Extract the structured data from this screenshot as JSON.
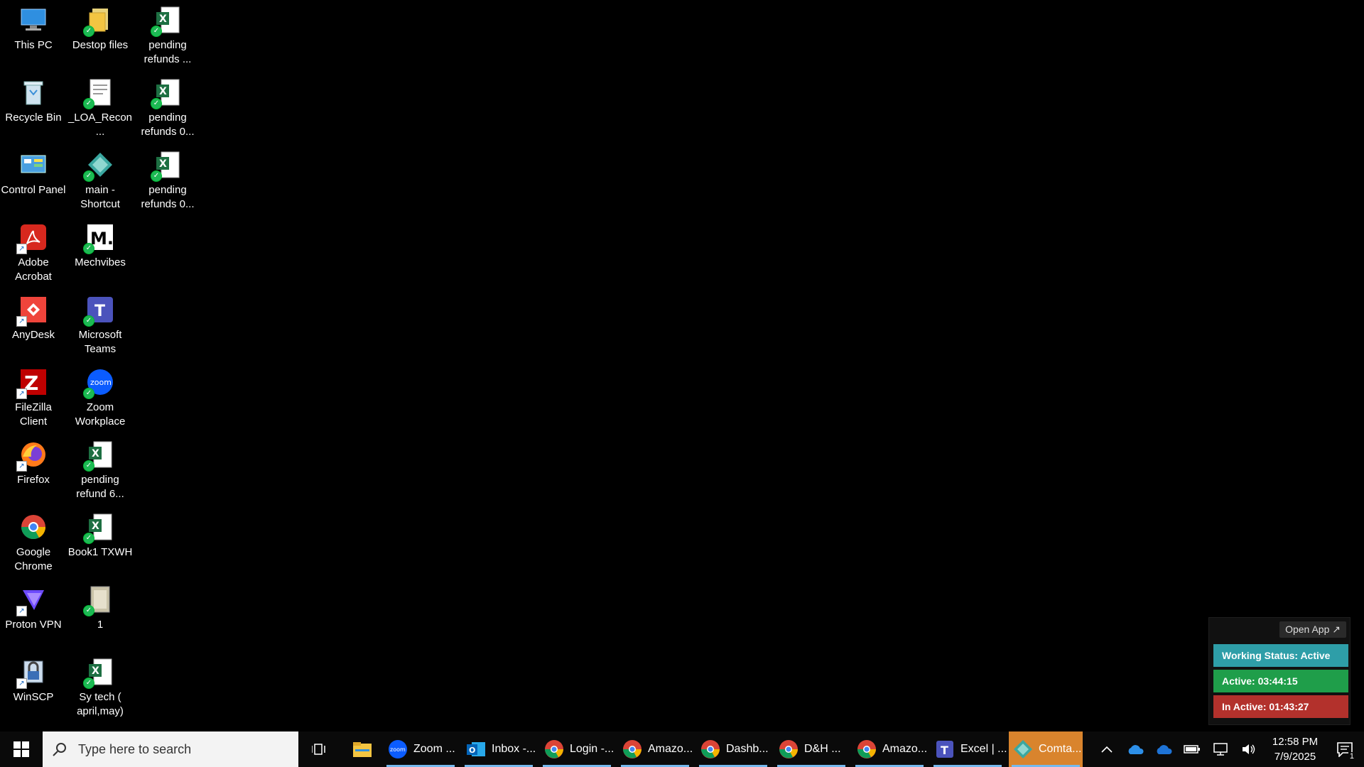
{
  "desktop": {
    "icons": [
      {
        "label": "This PC",
        "icon": "computer-icon"
      },
      {
        "label": "Recycle Bin",
        "icon": "recycle-bin-icon"
      },
      {
        "label": "Control Panel",
        "icon": "control-panel-icon"
      },
      {
        "label": "Adobe Acrobat",
        "icon": "acrobat-icon"
      },
      {
        "label": "AnyDesk",
        "icon": "anydesk-icon"
      },
      {
        "label": "FileZilla Client",
        "icon": "filezilla-icon"
      },
      {
        "label": "Firefox",
        "icon": "firefox-icon"
      },
      {
        "label": "Google Chrome",
        "icon": "chrome-icon"
      },
      {
        "label": "Proton VPN",
        "icon": "protonvpn-icon"
      },
      {
        "label": "WinSCP",
        "icon": "winscp-icon"
      },
      {
        "label": "Destop files",
        "icon": "folder-icon"
      },
      {
        "label": "_LOA_Recon...",
        "icon": "document-icon"
      },
      {
        "label": "main - Shortcut",
        "icon": "diamond-app-icon"
      },
      {
        "label": "Mechvibes",
        "icon": "mechvibes-icon"
      },
      {
        "label": "Microsoft Teams",
        "icon": "teams-icon"
      },
      {
        "label": "Zoom Workplace",
        "icon": "zoom-icon"
      },
      {
        "label": "pending refund 6...",
        "icon": "excel-icon"
      },
      {
        "label": "Book1 TXWH",
        "icon": "excel-icon"
      },
      {
        "label": "1",
        "icon": "archive-icon"
      },
      {
        "label": "Sy tech ( april,may)",
        "icon": "excel-icon"
      },
      {
        "label": "pending refunds ...",
        "icon": "excel-icon"
      },
      {
        "label": "pending refunds 0...",
        "icon": "excel-icon"
      },
      {
        "label": "pending refunds 0...",
        "icon": "excel-icon"
      }
    ]
  },
  "widget": {
    "open_app": "Open App ↗",
    "status": "Working Status: Active",
    "active": "Active: 03:44:15",
    "inactive": "In Active: 01:43:27",
    "colors": {
      "status": "#2e9ea8",
      "active": "#1f9e4a",
      "inactive": "#b3312c"
    }
  },
  "taskbar": {
    "search_placeholder": "Type here to search",
    "apps": [
      {
        "label": "Zoom ...",
        "icon": "zoom-icon"
      },
      {
        "label": "Inbox -...",
        "icon": "outlook-icon"
      },
      {
        "label": "Login -...",
        "icon": "chrome-icon"
      },
      {
        "label": "Amazo...",
        "icon": "chrome-icon"
      },
      {
        "label": "Dashb...",
        "icon": "chrome-icon"
      },
      {
        "label": "D&H ...",
        "icon": "chrome-icon"
      },
      {
        "label": "Amazo...",
        "icon": "chrome-icon"
      },
      {
        "label": "Excel | ...",
        "icon": "teams-icon"
      },
      {
        "label": "Comta...",
        "icon": "diamond-app-icon"
      }
    ],
    "active_app_color": "#d9842d",
    "clock": {
      "time": "12:58 PM",
      "date": "7/9/2025"
    },
    "notification_count": "1"
  }
}
